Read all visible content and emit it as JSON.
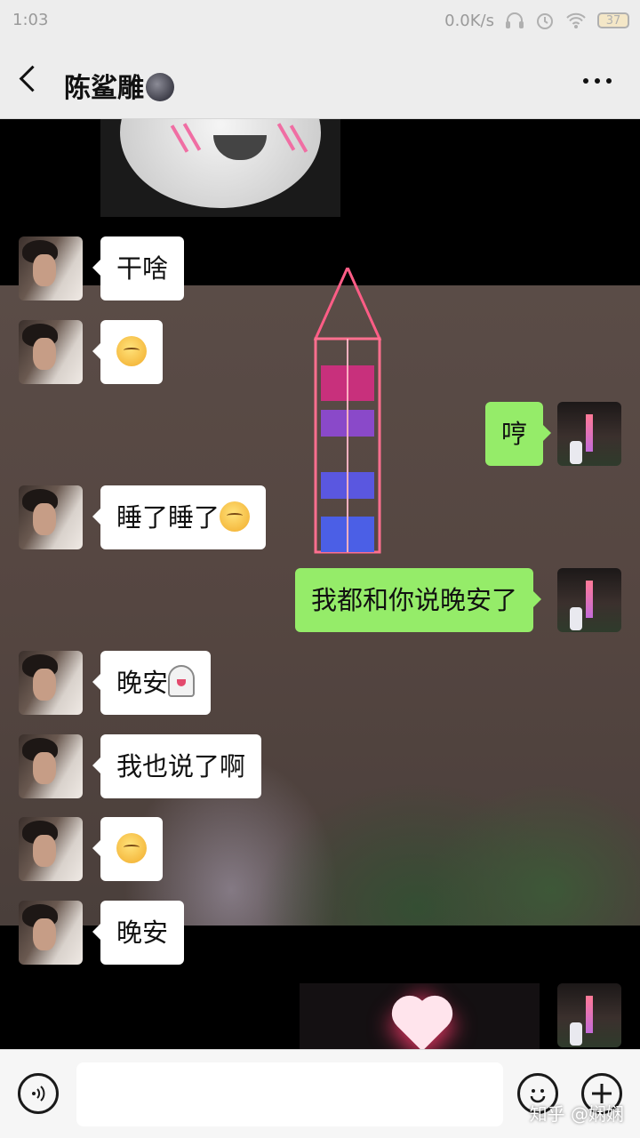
{
  "status_bar": {
    "time": "1:03",
    "network_speed": "0.0K/s",
    "battery": "37",
    "icons": [
      "headset-icon",
      "alarm-icon",
      "wifi-icon",
      "battery-icon"
    ]
  },
  "header": {
    "contact_name": "陈鲨雕",
    "name_emoji": "new-moon-face-icon",
    "back_icon": "chevron-left-icon",
    "more_icon": "more-dots-icon"
  },
  "messages": [
    {
      "side": "in",
      "type": "sticker",
      "content": "grinning-face-sticker"
    },
    {
      "side": "in",
      "type": "text",
      "text": "干啥"
    },
    {
      "side": "in",
      "type": "emoji",
      "emoji": "kissing-closed-eyes-emoji"
    },
    {
      "side": "out",
      "type": "text",
      "text": "哼"
    },
    {
      "side": "in",
      "type": "text",
      "text": "睡了睡了",
      "emoji": "kissing-closed-eyes-emoji"
    },
    {
      "side": "out",
      "type": "text",
      "text": "我都和你说晚安了"
    },
    {
      "side": "in",
      "type": "text",
      "text": "晚安",
      "emoji": "ghost-emoji"
    },
    {
      "side": "in",
      "type": "text",
      "text": "我也说了啊"
    },
    {
      "side": "in",
      "type": "emoji",
      "emoji": "kissing-closed-eyes-emoji"
    },
    {
      "side": "in",
      "type": "text",
      "text": "晚安"
    },
    {
      "side": "out",
      "type": "image",
      "content": "glowing-heart-photo"
    }
  ],
  "input_bar": {
    "voice_icon": "voice-icon",
    "input_value": "",
    "emoji_icon": "smiley-icon",
    "plus_icon": "plus-icon"
  },
  "watermark": "知乎 @娴娴",
  "colors": {
    "bubble_out": "#95ec69",
    "bubble_in": "#ffffff",
    "bar_bg": "#ededed"
  }
}
